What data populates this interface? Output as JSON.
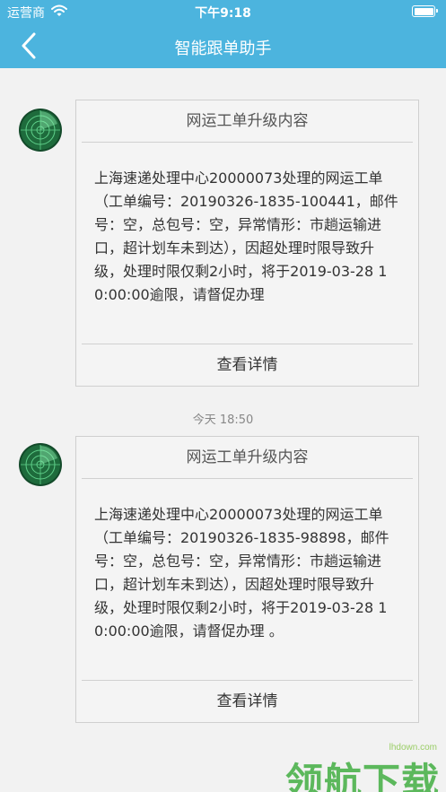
{
  "status_bar": {
    "carrier": "运营商",
    "time": "下午9:18"
  },
  "nav": {
    "title": "智能跟单助手",
    "back_icon": "chevron-left-icon"
  },
  "messages": [
    {
      "title": "网运工单升级内容",
      "body": "上海速递处理中心20000073处理的网运工单（工单编号：20190326-1835-100441，邮件号：空，总包号：空，异常情形：市趟运输进口，超计划车未到达），因超处理时限导致升级，处理时限仅剩2小时，将于2019-03-28 10:00:00逾限，请督促办理",
      "link": "查看详情"
    },
    {
      "title": "网运工单升级内容",
      "body": "上海速递处理中心20000073处理的网运工单（工单编号：20190326-1835-98898，邮件号：空，总包号：空，异常情形：市趟运输进口，超计划车未到达），因超处理时限导致升级，处理时限仅剩2小时，将于2019-03-28 10:00:00逾限，请督促办理 。",
      "link": "查看详情"
    }
  ],
  "timestamp": "今天 18:50",
  "watermark": {
    "url": "lhdown.com",
    "text": "领航下载"
  },
  "colors": {
    "header": "#4cb4de",
    "background": "#f2f2f2",
    "avatar": "#1e6b3c",
    "watermark": "#5cb85c"
  }
}
